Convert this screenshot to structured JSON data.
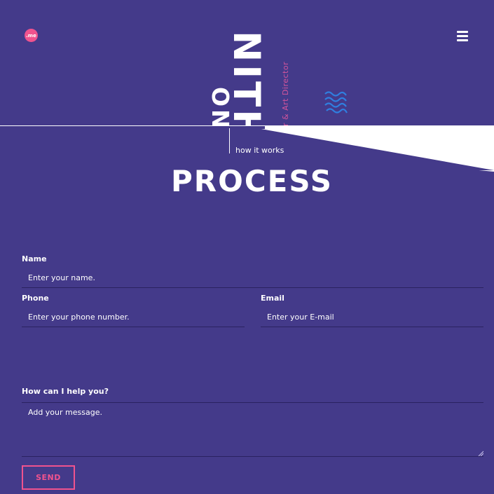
{
  "header": {
    "logo_text": ".me",
    "name_visible": "NITH",
    "name_partial": "ON",
    "tagline": "r & Art Director",
    "accent_color": "#f0538e",
    "wave_color": "#2f7fe0",
    "menu_icon": "hamburger-icon"
  },
  "section": {
    "label": "how it works",
    "title": "PROCESS"
  },
  "form": {
    "name_label": "Name",
    "name_placeholder": "Enter your name.",
    "phone_label": "Phone",
    "phone_placeholder": "Enter your phone number.",
    "email_label": "Email",
    "email_placeholder": "Enter your E-mail",
    "message_label": "How can I help you?",
    "message_placeholder": "Add your message.",
    "send_label": "SEND"
  }
}
